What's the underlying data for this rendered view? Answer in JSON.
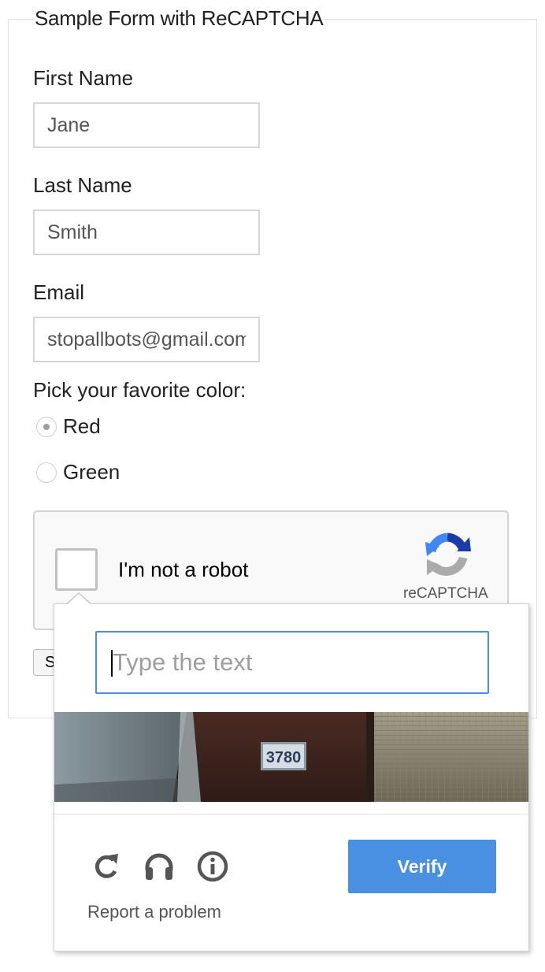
{
  "form": {
    "legend": "Sample Form with ReCAPTCHA",
    "fields": {
      "first_name": {
        "label": "First Name",
        "value": "Jane"
      },
      "last_name": {
        "label": "Last Name",
        "value": "Smith"
      },
      "email": {
        "label": "Email",
        "value": "stopallbots@gmail.com"
      }
    },
    "color_question": "Pick your favorite color:",
    "color_options": [
      {
        "label": "Red",
        "selected": true
      },
      {
        "label": "Green",
        "selected": false
      }
    ],
    "submit_label": "Submit"
  },
  "recaptcha": {
    "checkbox_label": "I'm not a robot",
    "brand": "reCAPTCHA",
    "checked": false
  },
  "challenge": {
    "input_placeholder": "Type the text",
    "input_value": "",
    "image_text": "3780",
    "icons": [
      "refresh-icon",
      "headphones-icon",
      "info-icon"
    ],
    "report_label": "Report a problem",
    "verify_label": "Verify",
    "accent_color": "#4a90e2"
  }
}
